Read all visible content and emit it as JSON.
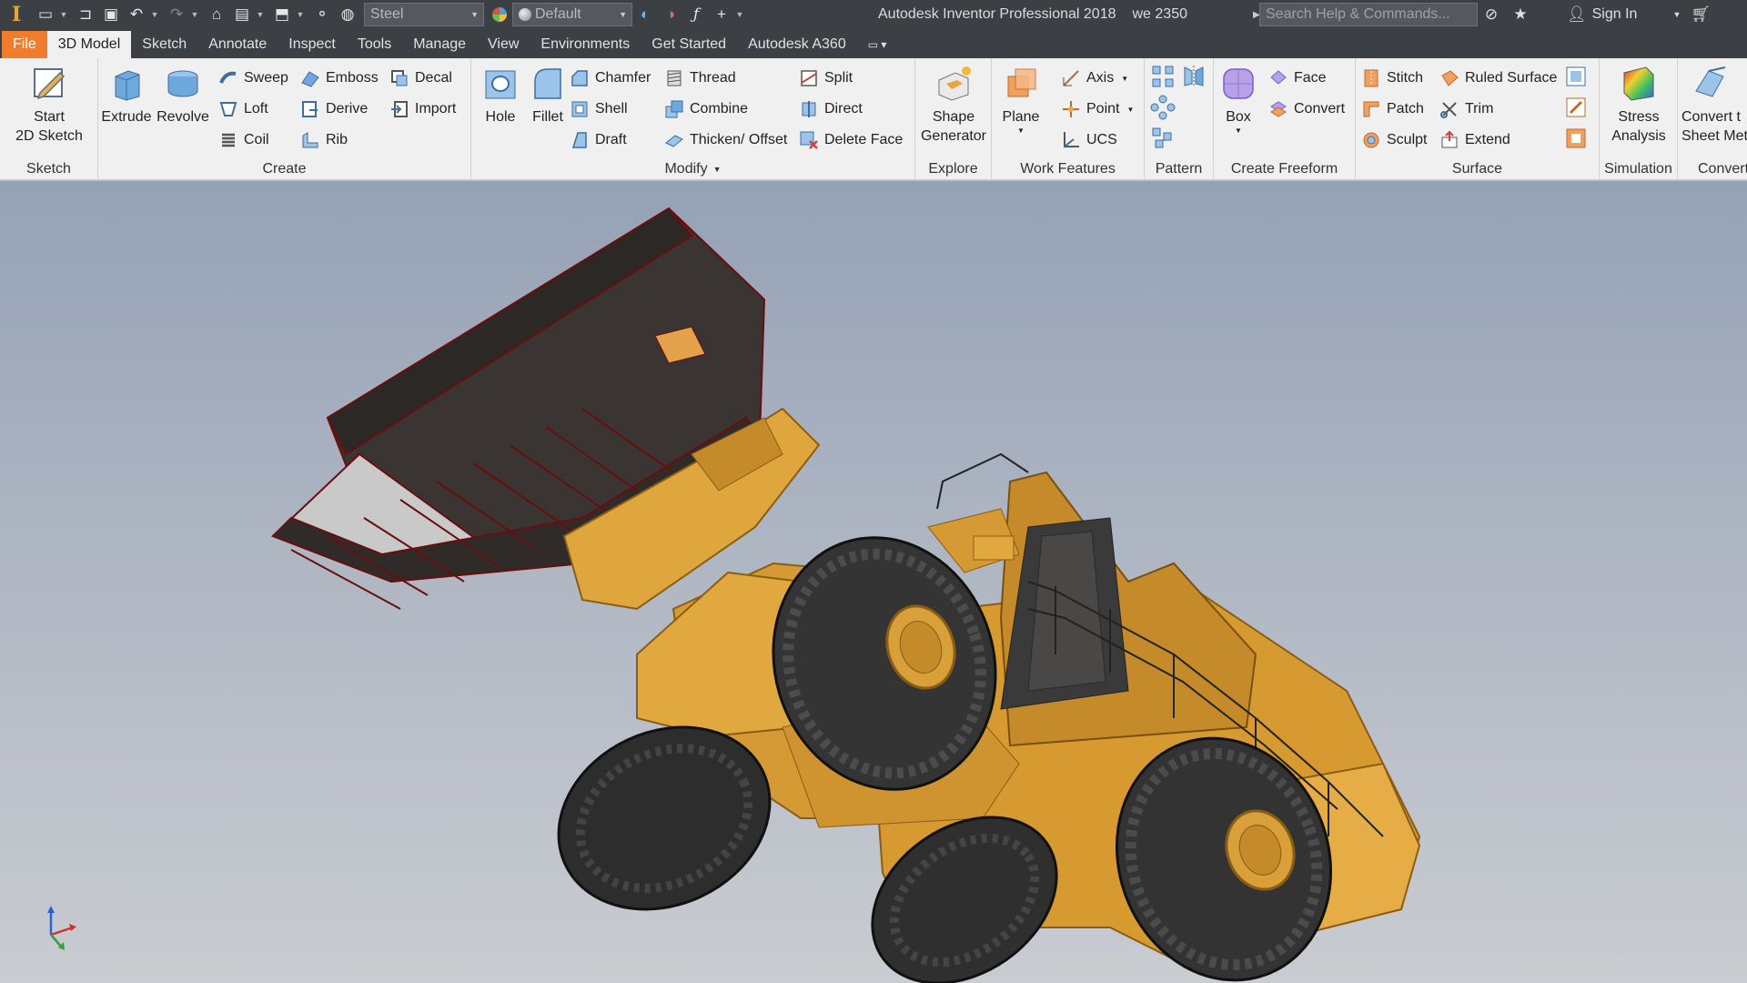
{
  "title_bar": {
    "material": "Steel",
    "appearance": "Default",
    "app_title": "Autodesk Inventor Professional 2018",
    "document": "we 2350",
    "search_placeholder": "Search Help & Commands...",
    "sign_in": "Sign In"
  },
  "tabs": [
    "File",
    "3D Model",
    "Sketch",
    "Annotate",
    "Inspect",
    "Tools",
    "Manage",
    "View",
    "Environments",
    "Get Started",
    "Autodesk A360"
  ],
  "panels": {
    "sketch": {
      "title": "Sketch",
      "start_line1": "Start",
      "start_line2": "2D Sketch"
    },
    "create": {
      "title": "Create",
      "extrude": "Extrude",
      "revolve": "Revolve",
      "sweep": "Sweep",
      "loft": "Loft",
      "coil": "Coil",
      "emboss": "Emboss",
      "derive": "Derive",
      "rib": "Rib",
      "decal": "Decal",
      "import": "Import"
    },
    "modify": {
      "title": "Modify",
      "hole": "Hole",
      "fillet": "Fillet",
      "chamfer": "Chamfer",
      "shell": "Shell",
      "draft": "Draft",
      "thread": "Thread",
      "combine": "Combine",
      "thicken": "Thicken/ Offset",
      "split": "Split",
      "direct": "Direct",
      "delete_face": "Delete Face"
    },
    "explore": {
      "title": "Explore",
      "shape_line1": "Shape",
      "shape_line2": "Generator"
    },
    "work_features": {
      "title": "Work Features",
      "plane": "Plane",
      "axis": "Axis",
      "point": "Point",
      "ucs": "UCS"
    },
    "pattern": {
      "title": "Pattern"
    },
    "freeform": {
      "title": "Create Freeform",
      "box": "Box",
      "face": "Face",
      "convert": "Convert"
    },
    "surface": {
      "title": "Surface",
      "stitch": "Stitch",
      "patch": "Patch",
      "sculpt": "Sculpt",
      "ruled": "Ruled Surface",
      "trim": "Trim",
      "extend": "Extend"
    },
    "simulation": {
      "title": "Simulation",
      "stress_line1": "Stress",
      "stress_line2": "Analysis"
    },
    "convert": {
      "title": "Convert",
      "line1": "Convert t",
      "line2": "Sheet Met"
    }
  },
  "colors": {
    "accent_file_tab": "#ef7d2b",
    "titlebar": "#3c3f44",
    "ribbon": "#f0f0f0",
    "model_yellow": "#e0a73b"
  }
}
